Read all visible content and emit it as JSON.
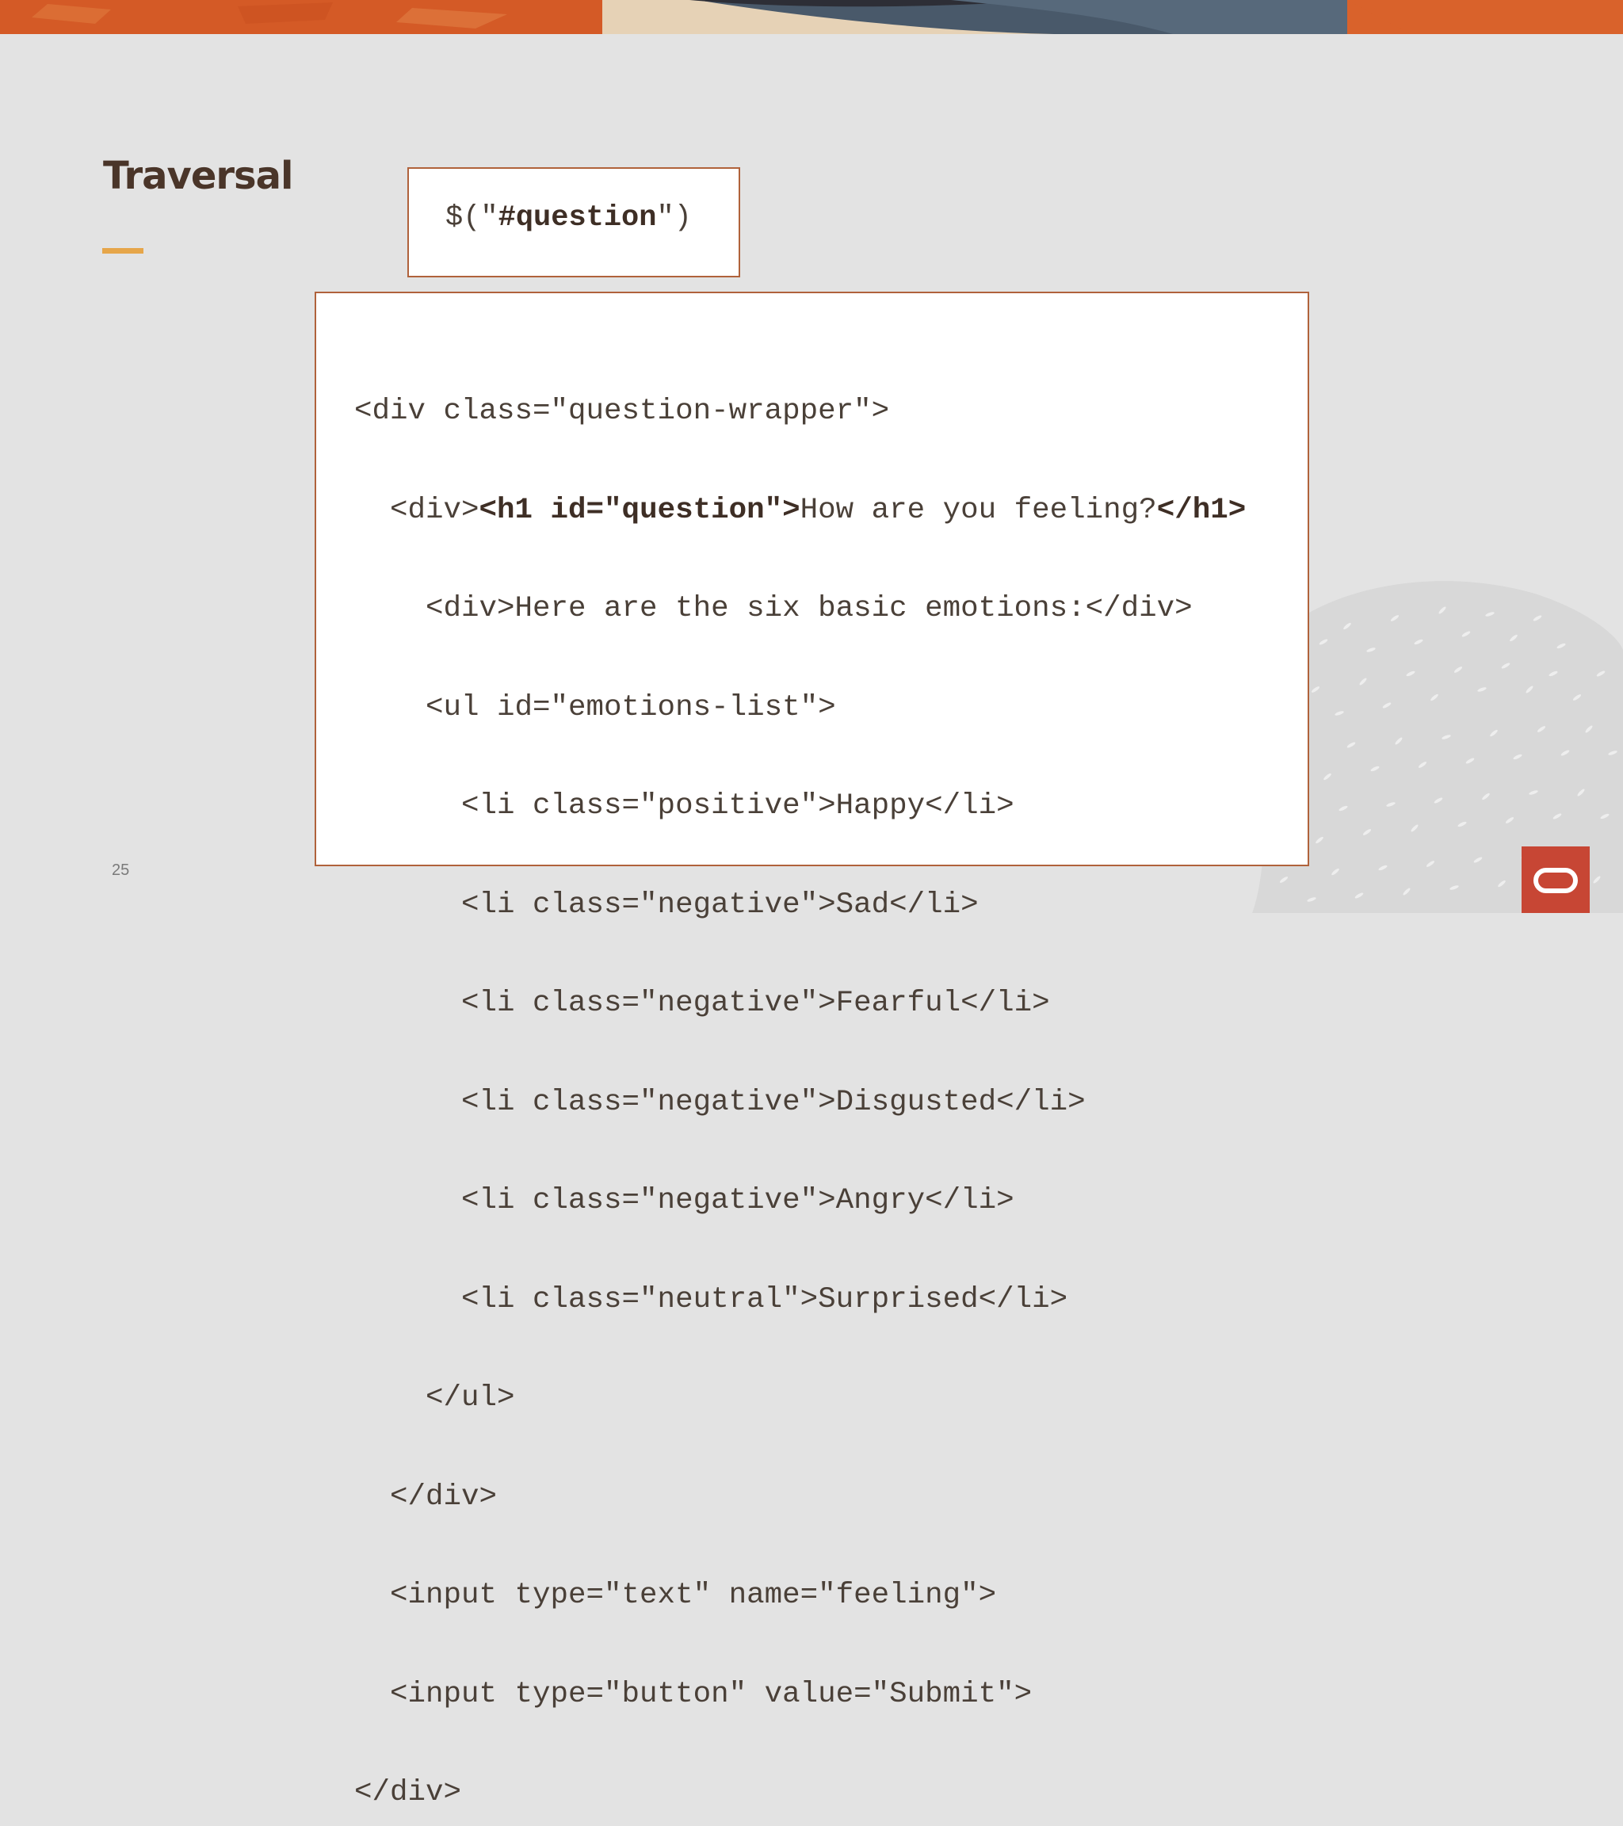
{
  "slide": {
    "title": "Traversal",
    "page_number": "25"
  },
  "selector": {
    "prefix": "$(\"",
    "bold": "#question",
    "suffix": "\")"
  },
  "code": {
    "lines": [
      {
        "text": "<div class=\"question-wrapper\">"
      },
      {
        "pre": "  <div>",
        "bold1": "<h1 id=\"question\">",
        "mid": "How are you feeling?",
        "bold2": "</h1>"
      },
      {
        "text": "    <div>Here are the six basic emotions:</div>"
      },
      {
        "text": "    <ul id=\"emotions-list\">"
      },
      {
        "text": "      <li class=\"positive\">Happy</li>"
      },
      {
        "text": "      <li class=\"negative\">Sad</li>"
      },
      {
        "text": "      <li class=\"negative\">Fearful</li>"
      },
      {
        "text": "      <li class=\"negative\">Disgusted</li>"
      },
      {
        "text": "      <li class=\"negative\">Angry</li>"
      },
      {
        "text": "      <li class=\"neutral\">Surprised</li>"
      },
      {
        "text": "    </ul>"
      },
      {
        "text": "  </div>"
      },
      {
        "text": "  <input type=\"text\" name=\"feeling\">"
      },
      {
        "text": "  <input type=\"button\" value=\"Submit\">"
      },
      {
        "text": "</div>"
      }
    ]
  },
  "colors": {
    "background": "#e3e3e3",
    "title": "#4a3529",
    "accent": "#e6a64a",
    "box_border": "#b0623b",
    "brand": "#c74634"
  },
  "icons": {
    "brand": "oracle-logo-icon"
  }
}
